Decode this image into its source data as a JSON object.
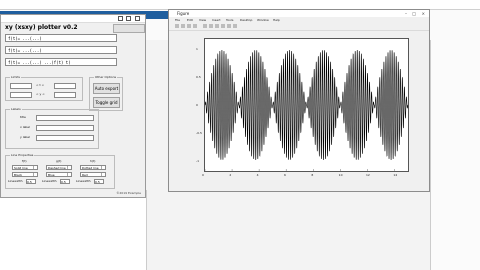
{
  "gui": {
    "title": "xy (xsxy) plotter v0.2",
    "top_button": "",
    "f1": "f(t)= ...(...)",
    "f2": "f(t)= ...(...)",
    "f3": "f(t)= ...(...) ...(f(t) t)",
    "limits_label": "Limits",
    "lim_row1": "< t <",
    "lim_row2": "< y <",
    "options_label": "Other Options",
    "btn_export": "Auto export",
    "btn_toggle": "Toggle grid",
    "labels_label": "Labels",
    "label_rows": [
      "title",
      "x label",
      "y label"
    ],
    "line_label": "Line Properties",
    "line_cols": [
      "f(t)",
      "g(t)",
      "h(t)"
    ],
    "line_opt1": [
      "Solid line",
      "Dashed line",
      "Dotted line"
    ],
    "line_opt2": [
      "Black",
      "Blue",
      "Red"
    ],
    "linewidth_label": "Linewidth",
    "linewidth_vals": [
      "0.5",
      "0.5",
      "0.5"
    ],
    "footer": "©2019 Example"
  },
  "figure": {
    "title": "Figure",
    "menu": [
      "File",
      "Edit",
      "View",
      "Insert",
      "Tools",
      "Desktop",
      "Window",
      "Help"
    ]
  },
  "chart_data": {
    "type": "line",
    "x_ticks": [
      "0",
      "2",
      "4",
      "6",
      "8",
      "10",
      "12",
      "14"
    ],
    "y_ticks": [
      "1",
      "0.5",
      "0",
      "-0.5",
      "-1"
    ],
    "xlim": [
      0,
      15
    ],
    "ylim": [
      -1.2,
      1.2
    ],
    "series": [
      {
        "carrier_cycles_per_unit": 3.0,
        "envelope_lobes": 6,
        "amplitude": 1.0
      }
    ]
  },
  "colors": {
    "accent": "#1f5e9e",
    "line": "#000000"
  }
}
